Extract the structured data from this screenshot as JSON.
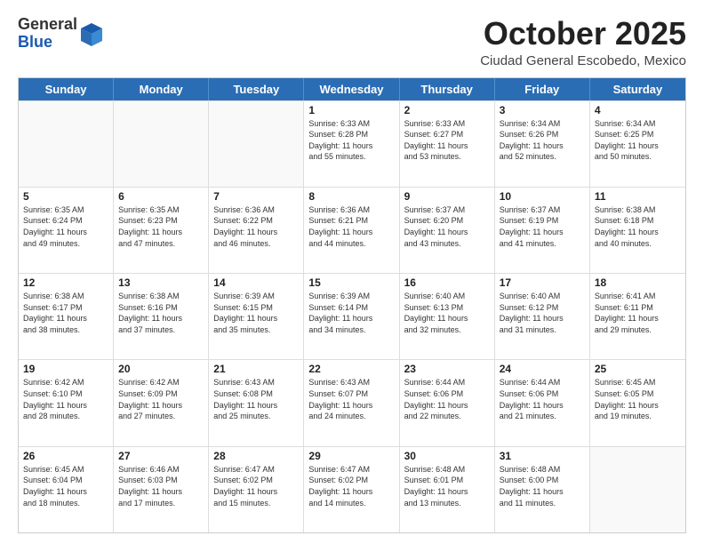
{
  "header": {
    "logo_general": "General",
    "logo_blue": "Blue",
    "month": "October 2025",
    "location": "Ciudad General Escobedo, Mexico"
  },
  "weekdays": [
    "Sunday",
    "Monday",
    "Tuesday",
    "Wednesday",
    "Thursday",
    "Friday",
    "Saturday"
  ],
  "rows": [
    [
      {
        "day": "",
        "info": ""
      },
      {
        "day": "",
        "info": ""
      },
      {
        "day": "",
        "info": ""
      },
      {
        "day": "1",
        "info": "Sunrise: 6:33 AM\nSunset: 6:28 PM\nDaylight: 11 hours\nand 55 minutes."
      },
      {
        "day": "2",
        "info": "Sunrise: 6:33 AM\nSunset: 6:27 PM\nDaylight: 11 hours\nand 53 minutes."
      },
      {
        "day": "3",
        "info": "Sunrise: 6:34 AM\nSunset: 6:26 PM\nDaylight: 11 hours\nand 52 minutes."
      },
      {
        "day": "4",
        "info": "Sunrise: 6:34 AM\nSunset: 6:25 PM\nDaylight: 11 hours\nand 50 minutes."
      }
    ],
    [
      {
        "day": "5",
        "info": "Sunrise: 6:35 AM\nSunset: 6:24 PM\nDaylight: 11 hours\nand 49 minutes."
      },
      {
        "day": "6",
        "info": "Sunrise: 6:35 AM\nSunset: 6:23 PM\nDaylight: 11 hours\nand 47 minutes."
      },
      {
        "day": "7",
        "info": "Sunrise: 6:36 AM\nSunset: 6:22 PM\nDaylight: 11 hours\nand 46 minutes."
      },
      {
        "day": "8",
        "info": "Sunrise: 6:36 AM\nSunset: 6:21 PM\nDaylight: 11 hours\nand 44 minutes."
      },
      {
        "day": "9",
        "info": "Sunrise: 6:37 AM\nSunset: 6:20 PM\nDaylight: 11 hours\nand 43 minutes."
      },
      {
        "day": "10",
        "info": "Sunrise: 6:37 AM\nSunset: 6:19 PM\nDaylight: 11 hours\nand 41 minutes."
      },
      {
        "day": "11",
        "info": "Sunrise: 6:38 AM\nSunset: 6:18 PM\nDaylight: 11 hours\nand 40 minutes."
      }
    ],
    [
      {
        "day": "12",
        "info": "Sunrise: 6:38 AM\nSunset: 6:17 PM\nDaylight: 11 hours\nand 38 minutes."
      },
      {
        "day": "13",
        "info": "Sunrise: 6:38 AM\nSunset: 6:16 PM\nDaylight: 11 hours\nand 37 minutes."
      },
      {
        "day": "14",
        "info": "Sunrise: 6:39 AM\nSunset: 6:15 PM\nDaylight: 11 hours\nand 35 minutes."
      },
      {
        "day": "15",
        "info": "Sunrise: 6:39 AM\nSunset: 6:14 PM\nDaylight: 11 hours\nand 34 minutes."
      },
      {
        "day": "16",
        "info": "Sunrise: 6:40 AM\nSunset: 6:13 PM\nDaylight: 11 hours\nand 32 minutes."
      },
      {
        "day": "17",
        "info": "Sunrise: 6:40 AM\nSunset: 6:12 PM\nDaylight: 11 hours\nand 31 minutes."
      },
      {
        "day": "18",
        "info": "Sunrise: 6:41 AM\nSunset: 6:11 PM\nDaylight: 11 hours\nand 29 minutes."
      }
    ],
    [
      {
        "day": "19",
        "info": "Sunrise: 6:42 AM\nSunset: 6:10 PM\nDaylight: 11 hours\nand 28 minutes."
      },
      {
        "day": "20",
        "info": "Sunrise: 6:42 AM\nSunset: 6:09 PM\nDaylight: 11 hours\nand 27 minutes."
      },
      {
        "day": "21",
        "info": "Sunrise: 6:43 AM\nSunset: 6:08 PM\nDaylight: 11 hours\nand 25 minutes."
      },
      {
        "day": "22",
        "info": "Sunrise: 6:43 AM\nSunset: 6:07 PM\nDaylight: 11 hours\nand 24 minutes."
      },
      {
        "day": "23",
        "info": "Sunrise: 6:44 AM\nSunset: 6:06 PM\nDaylight: 11 hours\nand 22 minutes."
      },
      {
        "day": "24",
        "info": "Sunrise: 6:44 AM\nSunset: 6:06 PM\nDaylight: 11 hours\nand 21 minutes."
      },
      {
        "day": "25",
        "info": "Sunrise: 6:45 AM\nSunset: 6:05 PM\nDaylight: 11 hours\nand 19 minutes."
      }
    ],
    [
      {
        "day": "26",
        "info": "Sunrise: 6:45 AM\nSunset: 6:04 PM\nDaylight: 11 hours\nand 18 minutes."
      },
      {
        "day": "27",
        "info": "Sunrise: 6:46 AM\nSunset: 6:03 PM\nDaylight: 11 hours\nand 17 minutes."
      },
      {
        "day": "28",
        "info": "Sunrise: 6:47 AM\nSunset: 6:02 PM\nDaylight: 11 hours\nand 15 minutes."
      },
      {
        "day": "29",
        "info": "Sunrise: 6:47 AM\nSunset: 6:02 PM\nDaylight: 11 hours\nand 14 minutes."
      },
      {
        "day": "30",
        "info": "Sunrise: 6:48 AM\nSunset: 6:01 PM\nDaylight: 11 hours\nand 13 minutes."
      },
      {
        "day": "31",
        "info": "Sunrise: 6:48 AM\nSunset: 6:00 PM\nDaylight: 11 hours\nand 11 minutes."
      },
      {
        "day": "",
        "info": ""
      }
    ]
  ]
}
